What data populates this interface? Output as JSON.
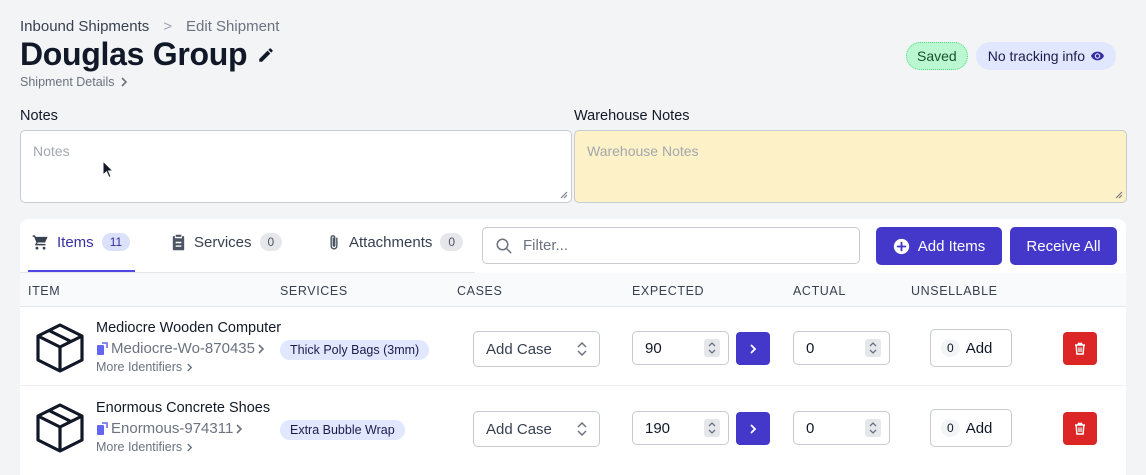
{
  "breadcrumb": {
    "parent": "Inbound Shipments",
    "separator": ">",
    "current": "Edit Shipment"
  },
  "title": "Douglas Group",
  "details_link": "Shipment Details",
  "badges": {
    "saved": "Saved",
    "tracking": "No tracking info"
  },
  "notes": {
    "label": "Notes",
    "placeholder": "Notes"
  },
  "warehouse_notes": {
    "label": "Warehouse Notes",
    "placeholder": "Warehouse Notes"
  },
  "tabs": [
    {
      "label": "Items",
      "count": "11",
      "active": true
    },
    {
      "label": "Services",
      "count": "0",
      "active": false
    },
    {
      "label": "Attachments",
      "count": "0",
      "active": false
    }
  ],
  "filter": {
    "placeholder": "Filter..."
  },
  "buttons": {
    "add_items": "Add Items",
    "receive_all": "Receive All"
  },
  "columns": [
    "ITEM",
    "SERVICES",
    "CASES",
    "EXPECTED",
    "ACTUAL",
    "UNSELLABLE"
  ],
  "rows": [
    {
      "name": "Mediocre Wooden Computer",
      "sku": "Mediocre-Wo-870435",
      "more": "More Identifiers",
      "service": "Thick Poly Bags (3mm)",
      "case_placeholder": "Add Case",
      "expected": "90",
      "actual": "0",
      "unsellable_count": "0",
      "unsellable_label": "Add"
    },
    {
      "name": "Enormous Concrete Shoes",
      "sku": "Enormous-974311",
      "more": "More Identifiers",
      "service": "Extra Bubble Wrap",
      "case_placeholder": "Add Case",
      "expected": "190",
      "actual": "0",
      "unsellable_count": "0",
      "unsellable_label": "Add"
    }
  ],
  "colors": {
    "primary": "#4338ca",
    "danger": "#dc2626",
    "saved_bg": "#bbf7d0",
    "warehouse_bg": "#fdf1c7",
    "tag_bg": "#e0e7ff"
  }
}
